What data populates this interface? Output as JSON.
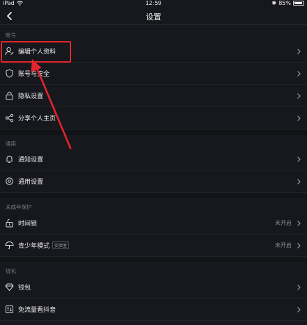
{
  "status_bar": {
    "device": "iPad",
    "time": "12:59",
    "battery": "85%",
    "battery_level": 0.85
  },
  "header": {
    "title": "设置",
    "back_icon": "chevron-left-icon"
  },
  "sections": [
    {
      "title": "账号",
      "items": [
        {
          "label": "编辑个人资料",
          "icon": "person-edit-icon"
        },
        {
          "label": "账号与安全",
          "icon": "shield-icon"
        },
        {
          "label": "隐私设置",
          "icon": "lock-icon"
        },
        {
          "label": "分享个人主页",
          "icon": "share-icon"
        }
      ]
    },
    {
      "title": "通用",
      "items": [
        {
          "label": "通知设置",
          "icon": "bell-icon"
        },
        {
          "label": "通用设置",
          "icon": "gear-icon"
        }
      ]
    },
    {
      "title": "未成年保护",
      "items": [
        {
          "label": "时间锁",
          "icon": "time-lock-icon",
          "value": "未开启"
        },
        {
          "label": "青少年模式",
          "icon": "umbrella-icon",
          "value": "未开启",
          "badge": "实验室"
        }
      ]
    },
    {
      "title": "钱包",
      "items": [
        {
          "label": "钱包",
          "icon": "diamond-icon"
        },
        {
          "label": "免流量看抖音",
          "icon": "traffic-icon"
        }
      ]
    }
  ],
  "annotation_color": "#e3252d"
}
